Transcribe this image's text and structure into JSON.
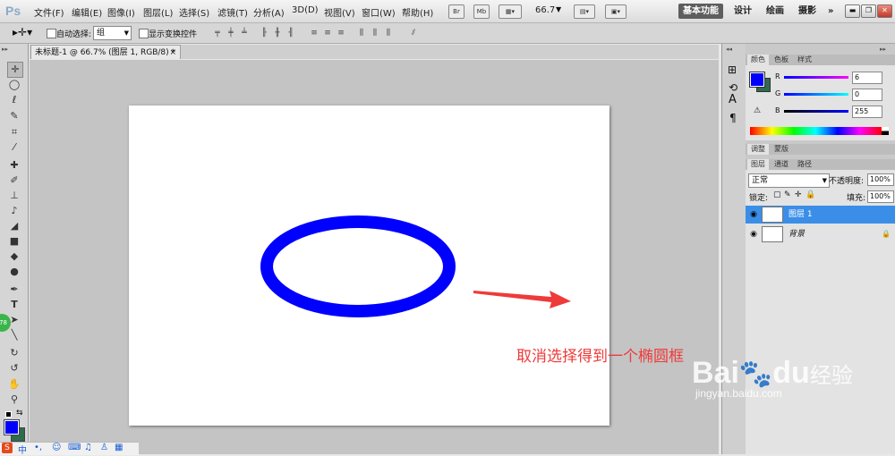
{
  "app": {
    "logo": "Ps"
  },
  "menu": [
    "文件(F)",
    "编辑(E)",
    "图像(I)",
    "图层(L)",
    "选择(S)",
    "滤镜(T)",
    "分析(A)",
    "3D(D)",
    "视图(V)",
    "窗口(W)",
    "帮助(H)"
  ],
  "top_controls": {
    "br": "Br",
    "mb": "Mb",
    "zoom": "66.7"
  },
  "workspaces": {
    "active": "基本功能",
    "items": [
      "设计",
      "绘画",
      "摄影"
    ],
    "more": "»"
  },
  "options": {
    "auto_select_label": "自动选择:",
    "auto_select_value": "组",
    "show_transform_label": "显示变换控件"
  },
  "document": {
    "tab_title": "未标题-1 @ 66.7% (图层 1, RGB/8) *",
    "close": "×"
  },
  "colors": {
    "foreground": "#0000ff",
    "background": "#2e6b4f",
    "ellipse": "#0000ff",
    "arrow": "#ef3a3a"
  },
  "color_panel": {
    "tabs": [
      "颜色",
      "色板",
      "样式"
    ],
    "r_label": "R",
    "r_value": "6",
    "g_label": "G",
    "g_value": "0",
    "b_label": "B",
    "b_value": "255"
  },
  "adjust_tabs": [
    "调整",
    "蒙版"
  ],
  "layers_panel": {
    "tabs": [
      "图层",
      "通道",
      "路径"
    ],
    "blend_mode": "正常",
    "opacity_label": "不透明度:",
    "opacity_value": "100%",
    "lock_label": "锁定:",
    "fill_label": "填充:",
    "fill_value": "100%",
    "layers": [
      {
        "name": "图层 1",
        "selected": true
      },
      {
        "name": "背景",
        "selected": false
      }
    ]
  },
  "annotation": "取消选择得到一个椭圆框",
  "badge": "78",
  "watermark": {
    "brand": "Bai",
    "du": "du",
    "jingyan": "经验",
    "url": "jingyan.baidu.com"
  },
  "ime": {
    "label": "中"
  }
}
